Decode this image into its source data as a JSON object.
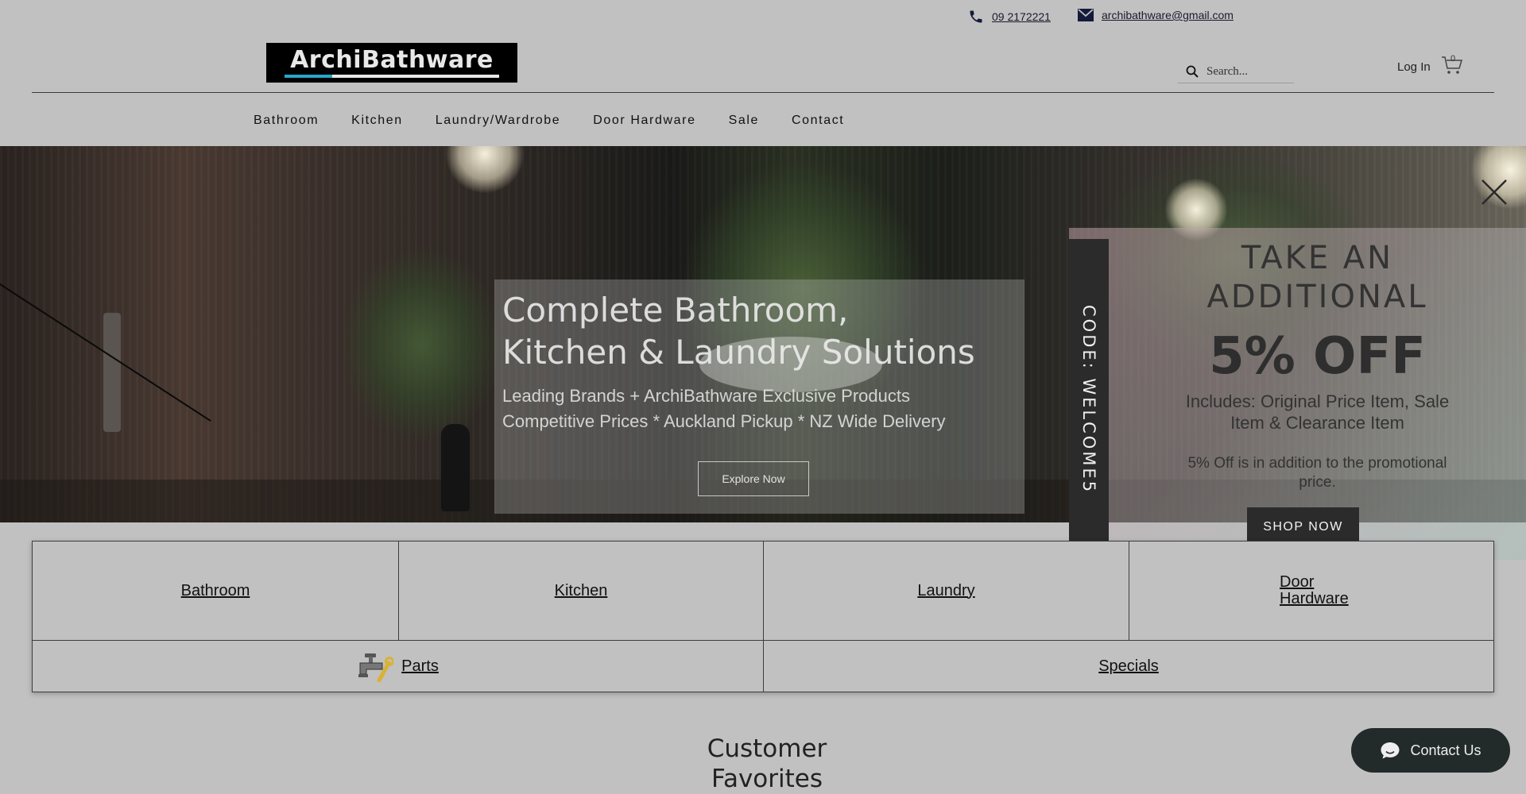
{
  "header": {
    "phone": "09 2172221",
    "email": "archibathware@gmail.com",
    "logo_text": "ArchiBathware",
    "search_placeholder": "Search...",
    "login_label": "Log In",
    "cart_count": "0"
  },
  "nav": {
    "items": [
      {
        "label": "Bathroom"
      },
      {
        "label": "Kitchen"
      },
      {
        "label": "Laundry/Wardrobe"
      },
      {
        "label": "Door Hardware"
      },
      {
        "label": "Sale"
      },
      {
        "label": "Contact"
      }
    ]
  },
  "hero": {
    "title_line1": "Complete Bathroom,",
    "title_line2": "Kitchen & Laundry Solutions",
    "subtitle_line1": "Leading Brands + ArchiBathware Exclusive Products",
    "subtitle_line2": "Competitive Prices * Auckland Pickup * NZ Wide Delivery",
    "cta_label": "Explore Now"
  },
  "promo": {
    "code_tab": "CODE: WELCOME5",
    "heading_line1": "TAKE AN",
    "heading_line2": "ADDITIONAL",
    "big_text": "5% OFF",
    "includes": "Includes: Original Price Item, Sale Item & Clearance Item",
    "note": "5% Off is in addition to the promotional price.",
    "button_label": "SHOP NOW"
  },
  "categories": {
    "bathroom": "Bathroom",
    "kitchen": "Kitchen",
    "laundry": "Laundry",
    "door_hardware": "Door Hardware",
    "parts": "Parts",
    "specials": "Specials"
  },
  "section": {
    "title_line1": "Customer",
    "title_line2": "Favorites"
  },
  "chat": {
    "label": "Contact Us"
  },
  "colors": {
    "overlay_bg": "#c1c1c1",
    "logo_accent": "#2aa6c9",
    "promo_dark": "#2b2b2b",
    "chat_bg": "#232a2a"
  },
  "icons": {
    "phone": "phone-icon",
    "email": "mail-icon",
    "search": "search-icon",
    "cart": "cart-icon",
    "close": "close-icon",
    "parts": "faucet-wrench-icon",
    "chat": "chat-bubble-icon"
  }
}
